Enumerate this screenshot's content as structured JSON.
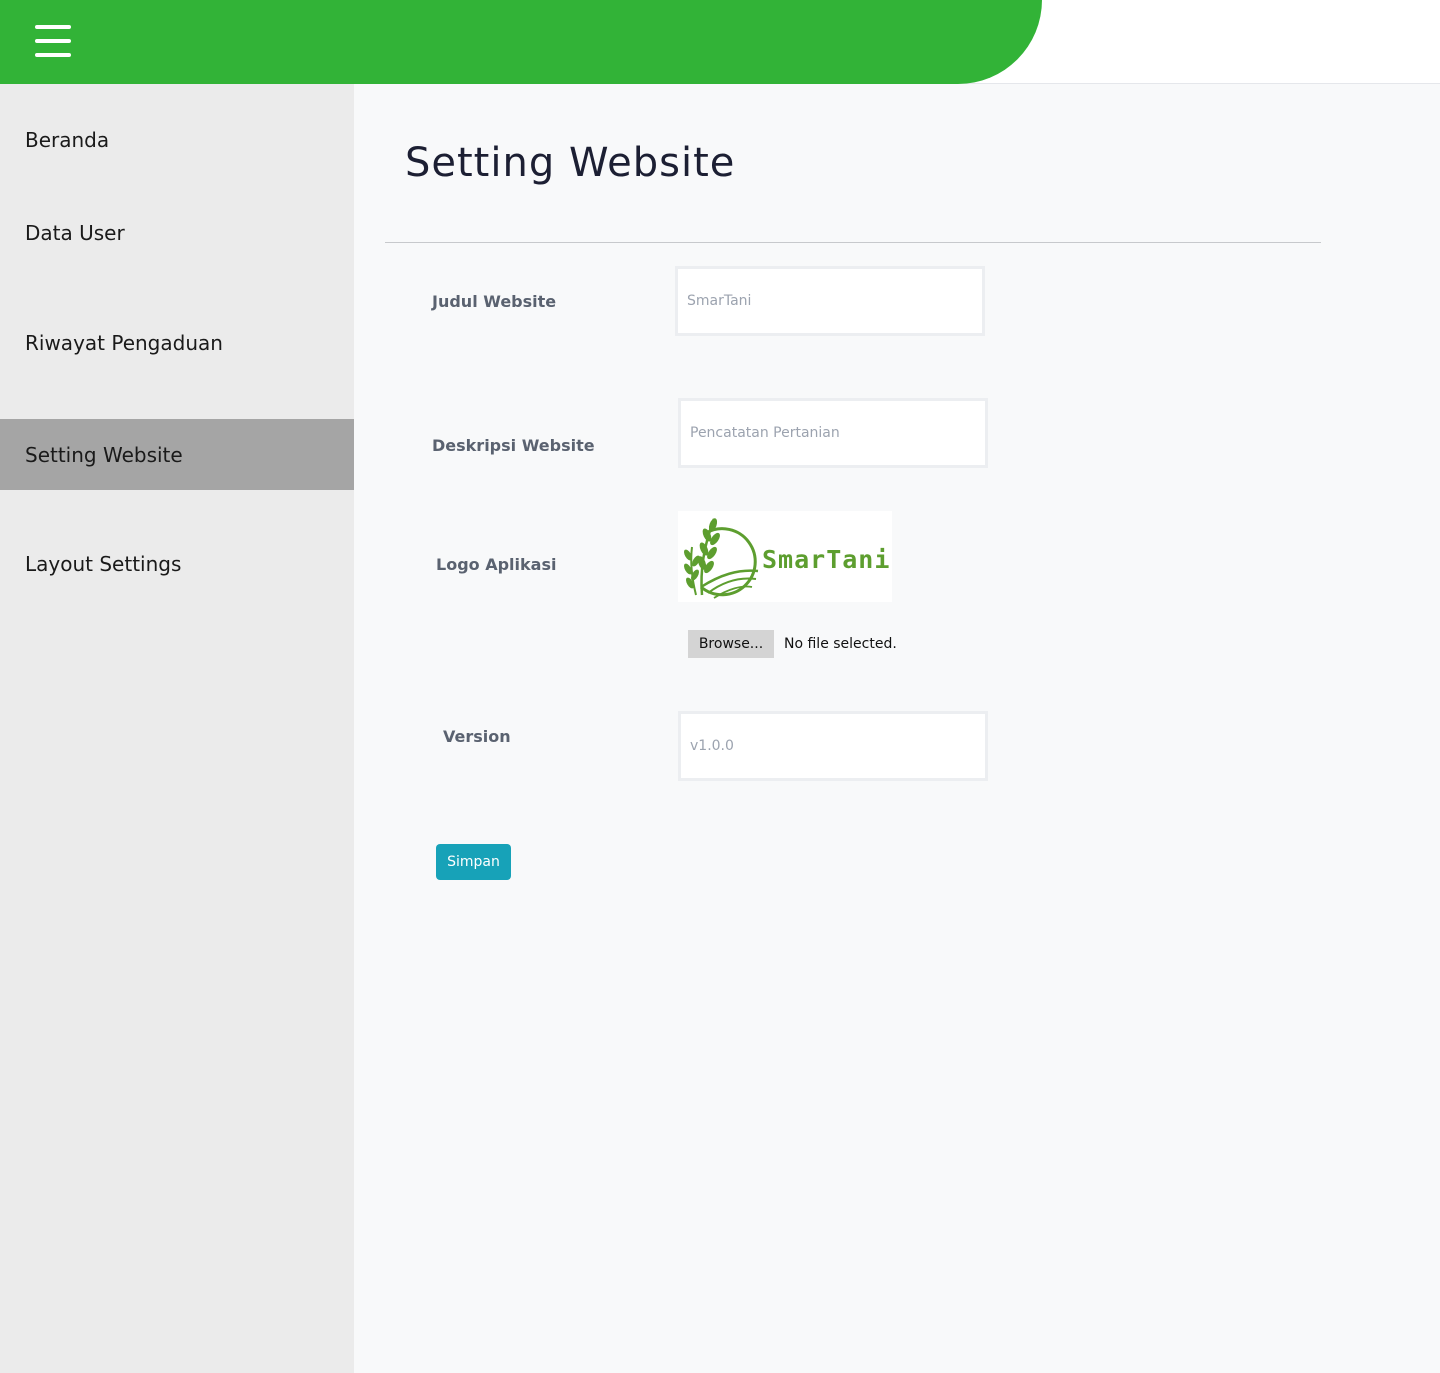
{
  "sidebar": {
    "items": [
      {
        "label": "Beranda"
      },
      {
        "label": "Data User"
      },
      {
        "label": "Riwayat Pengaduan"
      },
      {
        "label": "Setting Website",
        "active": true
      },
      {
        "label": "Layout Settings"
      }
    ]
  },
  "main": {
    "title": "Setting Website",
    "form": {
      "judul_label": "Judul Website",
      "judul_placeholder": "SmarTani",
      "deskripsi_label": "Deskripsi Website",
      "deskripsi_placeholder": "Pencatatan Pertanian",
      "logo_label": "Logo Aplikasi",
      "logo_text": "SmarTani",
      "browse_label": "Browse...",
      "file_status": "No file selected.",
      "version_label": "Version",
      "version_placeholder": "v1.0.0",
      "save_label": "Simpan"
    }
  },
  "colors": {
    "header_green": "#32b337",
    "sidebar_bg": "#ebebeb",
    "sidebar_active": "#a5a5a5",
    "save_button": "#17a2b8",
    "logo_green": "#5d9e2f"
  },
  "icons": {
    "menu": "hamburger-menu-icon",
    "logo": "rice-plant-logo-icon"
  }
}
